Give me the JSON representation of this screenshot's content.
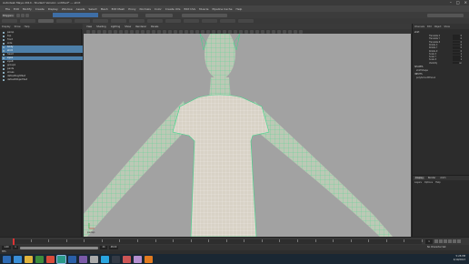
{
  "window": {
    "title": "Autodesk Maya 2014 - Student Version: untitled* --- shirt",
    "controls": [
      "minimize-icon",
      "maximize-icon",
      "close-icon"
    ]
  },
  "menubar": {
    "items": [
      "File",
      "Edit",
      "Modify",
      "Create",
      "Display",
      "Window",
      "Assets",
      "Select",
      "Mesh",
      "Edit Mesh",
      "Proxy",
      "Normals",
      "Color",
      "Create UVs",
      "Edit UVs",
      "Muscle",
      "Pipeline Cache",
      "Help"
    ]
  },
  "statusline": {
    "mode": "Polygons"
  },
  "outliner": {
    "menu": [
      "Display",
      "Show",
      "Help"
    ],
    "items": [
      {
        "label": "persp",
        "selected": false
      },
      {
        "label": "top",
        "selected": false
      },
      {
        "label": "front",
        "selected": false
      },
      {
        "label": "side",
        "selected": false
      },
      {
        "label": "body",
        "selected": true
      },
      {
        "label": "shirt",
        "selected": true
      },
      {
        "label": "head",
        "selected": false
      },
      {
        "label": "eyeL",
        "selected": true
      },
      {
        "label": "eyeR",
        "selected": false
      },
      {
        "label": "group1",
        "selected": false
      },
      {
        "label": "pants",
        "selected": false
      },
      {
        "label": "shoes",
        "selected": false
      },
      {
        "label": "defaultLightSet",
        "selected": false
      },
      {
        "label": "defaultObjectSet",
        "selected": false
      }
    ]
  },
  "viewport": {
    "menu": [
      "View",
      "Shading",
      "Lighting",
      "Show",
      "Renderer",
      "Panels"
    ],
    "camera_label": "persp",
    "background_color": "#a2a2a2",
    "wire_color": "#3fd78a",
    "skin_color": "#bcc9b6",
    "shirt_color": "#d8d2c6"
  },
  "channelbox": {
    "tabs": [
      "Channels",
      "Edit",
      "Object",
      "Show"
    ],
    "object_name": "shirt",
    "attributes": [
      {
        "name": "Translate X",
        "value": "0"
      },
      {
        "name": "Translate Y",
        "value": "0"
      },
      {
        "name": "Translate Z",
        "value": "0"
      },
      {
        "name": "Rotate X",
        "value": "0"
      },
      {
        "name": "Rotate Y",
        "value": "0"
      },
      {
        "name": "Rotate Z",
        "value": "0"
      },
      {
        "name": "Scale X",
        "value": "1"
      },
      {
        "name": "Scale Y",
        "value": "1"
      },
      {
        "name": "Scale Z",
        "value": "1"
      },
      {
        "name": "Visibility",
        "value": "on"
      }
    ],
    "shapes_label": "SHAPES",
    "shape_name": "shirtShape",
    "inputs_label": "INPUTS",
    "input_name": "polySmoothFace1"
  },
  "layers": {
    "tabs": [
      "Display",
      "Render",
      "Anim"
    ],
    "menu": [
      "Layers",
      "Options",
      "Help"
    ]
  },
  "timeline": {
    "start": "1",
    "end": "24",
    "current": "1",
    "range_start": "1.00",
    "range_end": "48.00",
    "char_set": "No Character Set"
  },
  "commandline": {
    "label": "MEL"
  },
  "taskbar": {
    "time": "5:28 PM",
    "date": "4/19/2013",
    "apps": [
      "start-icon",
      "ie-icon",
      "folder-icon",
      "media-icon",
      "chrome-icon",
      "maya-icon",
      "photoshop-icon",
      "mudbox-icon",
      "notepad-icon",
      "skype-icon",
      "steam-icon",
      "paint-icon",
      "itunes-icon",
      "vlc-icon"
    ]
  }
}
